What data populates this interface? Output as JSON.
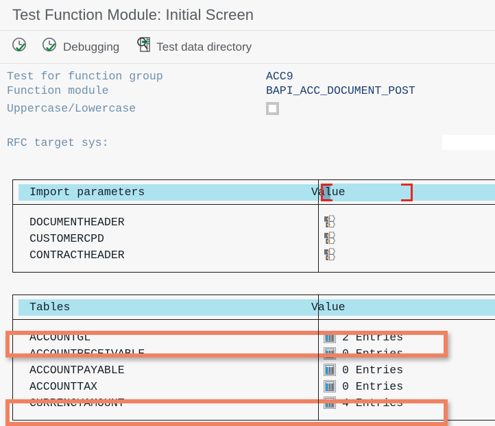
{
  "window": {
    "title": "Test Function Module: Initial Screen"
  },
  "toolbar": {
    "items": [
      {
        "icon": "execute-icon",
        "label": ""
      },
      {
        "icon": "execute-debug-icon",
        "label": "Debugging"
      },
      {
        "icon": "test-data-directory-icon",
        "label": "Test data directory"
      }
    ]
  },
  "form": {
    "rows": [
      {
        "label": "Test for function group",
        "value": "ACC9",
        "type": "text"
      },
      {
        "label": "Function module",
        "value": "BAPI_ACC_DOCUMENT_POST",
        "type": "text"
      },
      {
        "label": "Uppercase/Lowercase",
        "value": "",
        "type": "checkbox",
        "checked": false
      }
    ],
    "rfc": {
      "label": "RFC target sys:",
      "value": "",
      "placeholder": ""
    }
  },
  "import_parameters": {
    "header": {
      "name": "Import parameters",
      "value": "Value"
    },
    "rows": [
      {
        "name": "DOCUMENTHEADER",
        "value": "",
        "icon": "structure-puzzle-icon"
      },
      {
        "name": "CUSTOMERCPD",
        "value": "",
        "icon": "structure-puzzle-icon"
      },
      {
        "name": "CONTRACTHEADER",
        "value": "",
        "icon": "structure-puzzle-icon"
      }
    ]
  },
  "tables": {
    "header": {
      "name": "Tables",
      "value": "Value"
    },
    "rows": [
      {
        "name": "ACCOUNTGL",
        "value": "2 Entries",
        "icon": "table-grid-icon",
        "highlighted": true
      },
      {
        "name": "ACCOUNTRECEIVABLE",
        "value": "0 Entries",
        "icon": "table-grid-icon",
        "highlighted": false
      },
      {
        "name": "ACCOUNTPAYABLE",
        "value": "0 Entries",
        "icon": "table-grid-icon",
        "highlighted": false
      },
      {
        "name": "ACCOUNTTAX",
        "value": "0 Entries",
        "icon": "table-grid-icon",
        "highlighted": false
      },
      {
        "name": "CURRENCYAMOUNT",
        "value": "4 Entries",
        "icon": "table-grid-icon",
        "highlighted": true
      }
    ]
  },
  "annotations": {
    "value_focus": {
      "target": "Value",
      "color": "#e8281e"
    },
    "highlight_color": "#f08262"
  }
}
